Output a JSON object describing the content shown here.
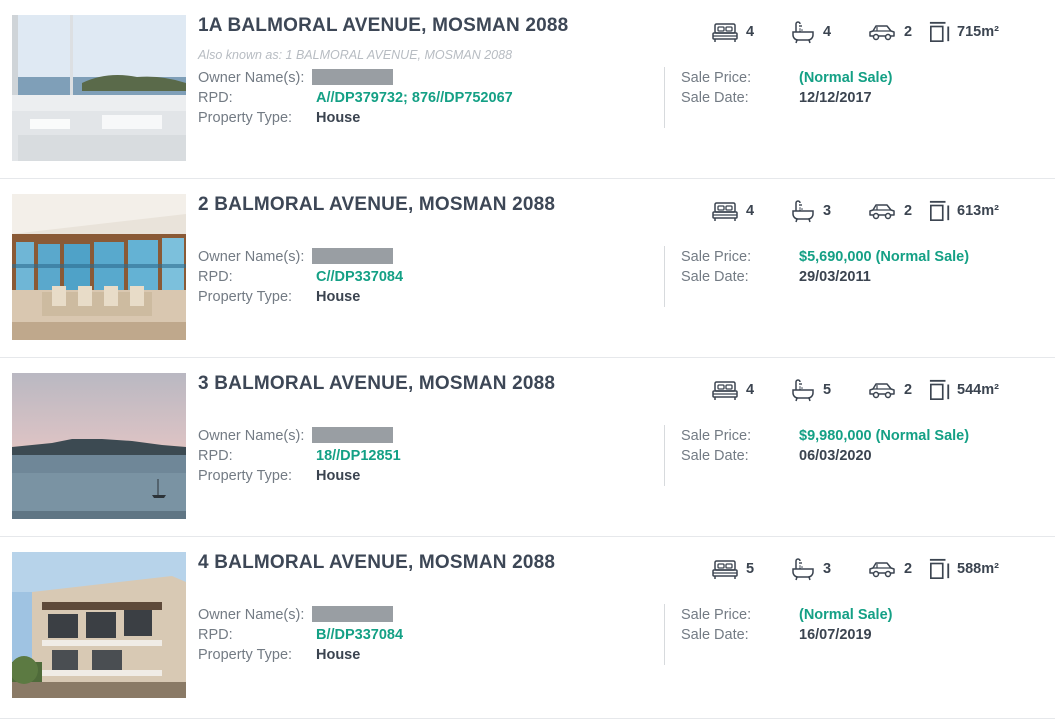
{
  "labels": {
    "owner": "Owner Name(s):",
    "rpd": "RPD:",
    "type": "Property Type:",
    "sale_price": "Sale Price:",
    "sale_date": "Sale Date:"
  },
  "properties": [
    {
      "address": "1A BALMORAL AVENUE, MOSMAN 2088",
      "aka": "Also known as: 1 BALMORAL AVENUE, MOSMAN 2088",
      "rpd": "A//DP379732; 876//DP752067",
      "type": "House",
      "sale_price": " (Normal Sale)",
      "sale_date": "12/12/2017",
      "beds": "4",
      "baths": "4",
      "cars": "2",
      "land": "715m²",
      "image": "white-interior-harbour-view"
    },
    {
      "address": "2 BALMORAL AVENUE, MOSMAN 2088",
      "rpd": "C//DP337084",
      "type": "House",
      "sale_price": "$5,690,000 (Normal Sale)",
      "sale_date": "29/03/2011",
      "beds": "4",
      "baths": "3",
      "cars": "2",
      "land": "613m²",
      "image": "dining-room-glass-doors"
    },
    {
      "address": "3 BALMORAL AVENUE, MOSMAN 2088",
      "rpd": "18//DP12851",
      "type": "House",
      "sale_price": "$9,980,000 (Normal Sale)",
      "sale_date": "06/03/2020",
      "beds": "4",
      "baths": "5",
      "cars": "2",
      "land": "544m²",
      "image": "harbour-dusk-view"
    },
    {
      "address": "4 BALMORAL AVENUE, MOSMAN 2088",
      "rpd": "B//DP337084",
      "type": "House",
      "sale_price": " (Normal Sale)",
      "sale_date": "16/07/2019",
      "beds": "5",
      "baths": "3",
      "cars": "2",
      "land": "588m²",
      "image": "house-exterior-balconies"
    }
  ],
  "colors": {
    "accent_green": "#14a085",
    "heading": "#3d4756",
    "label": "#737b84",
    "redaction": "#999ea3"
  }
}
